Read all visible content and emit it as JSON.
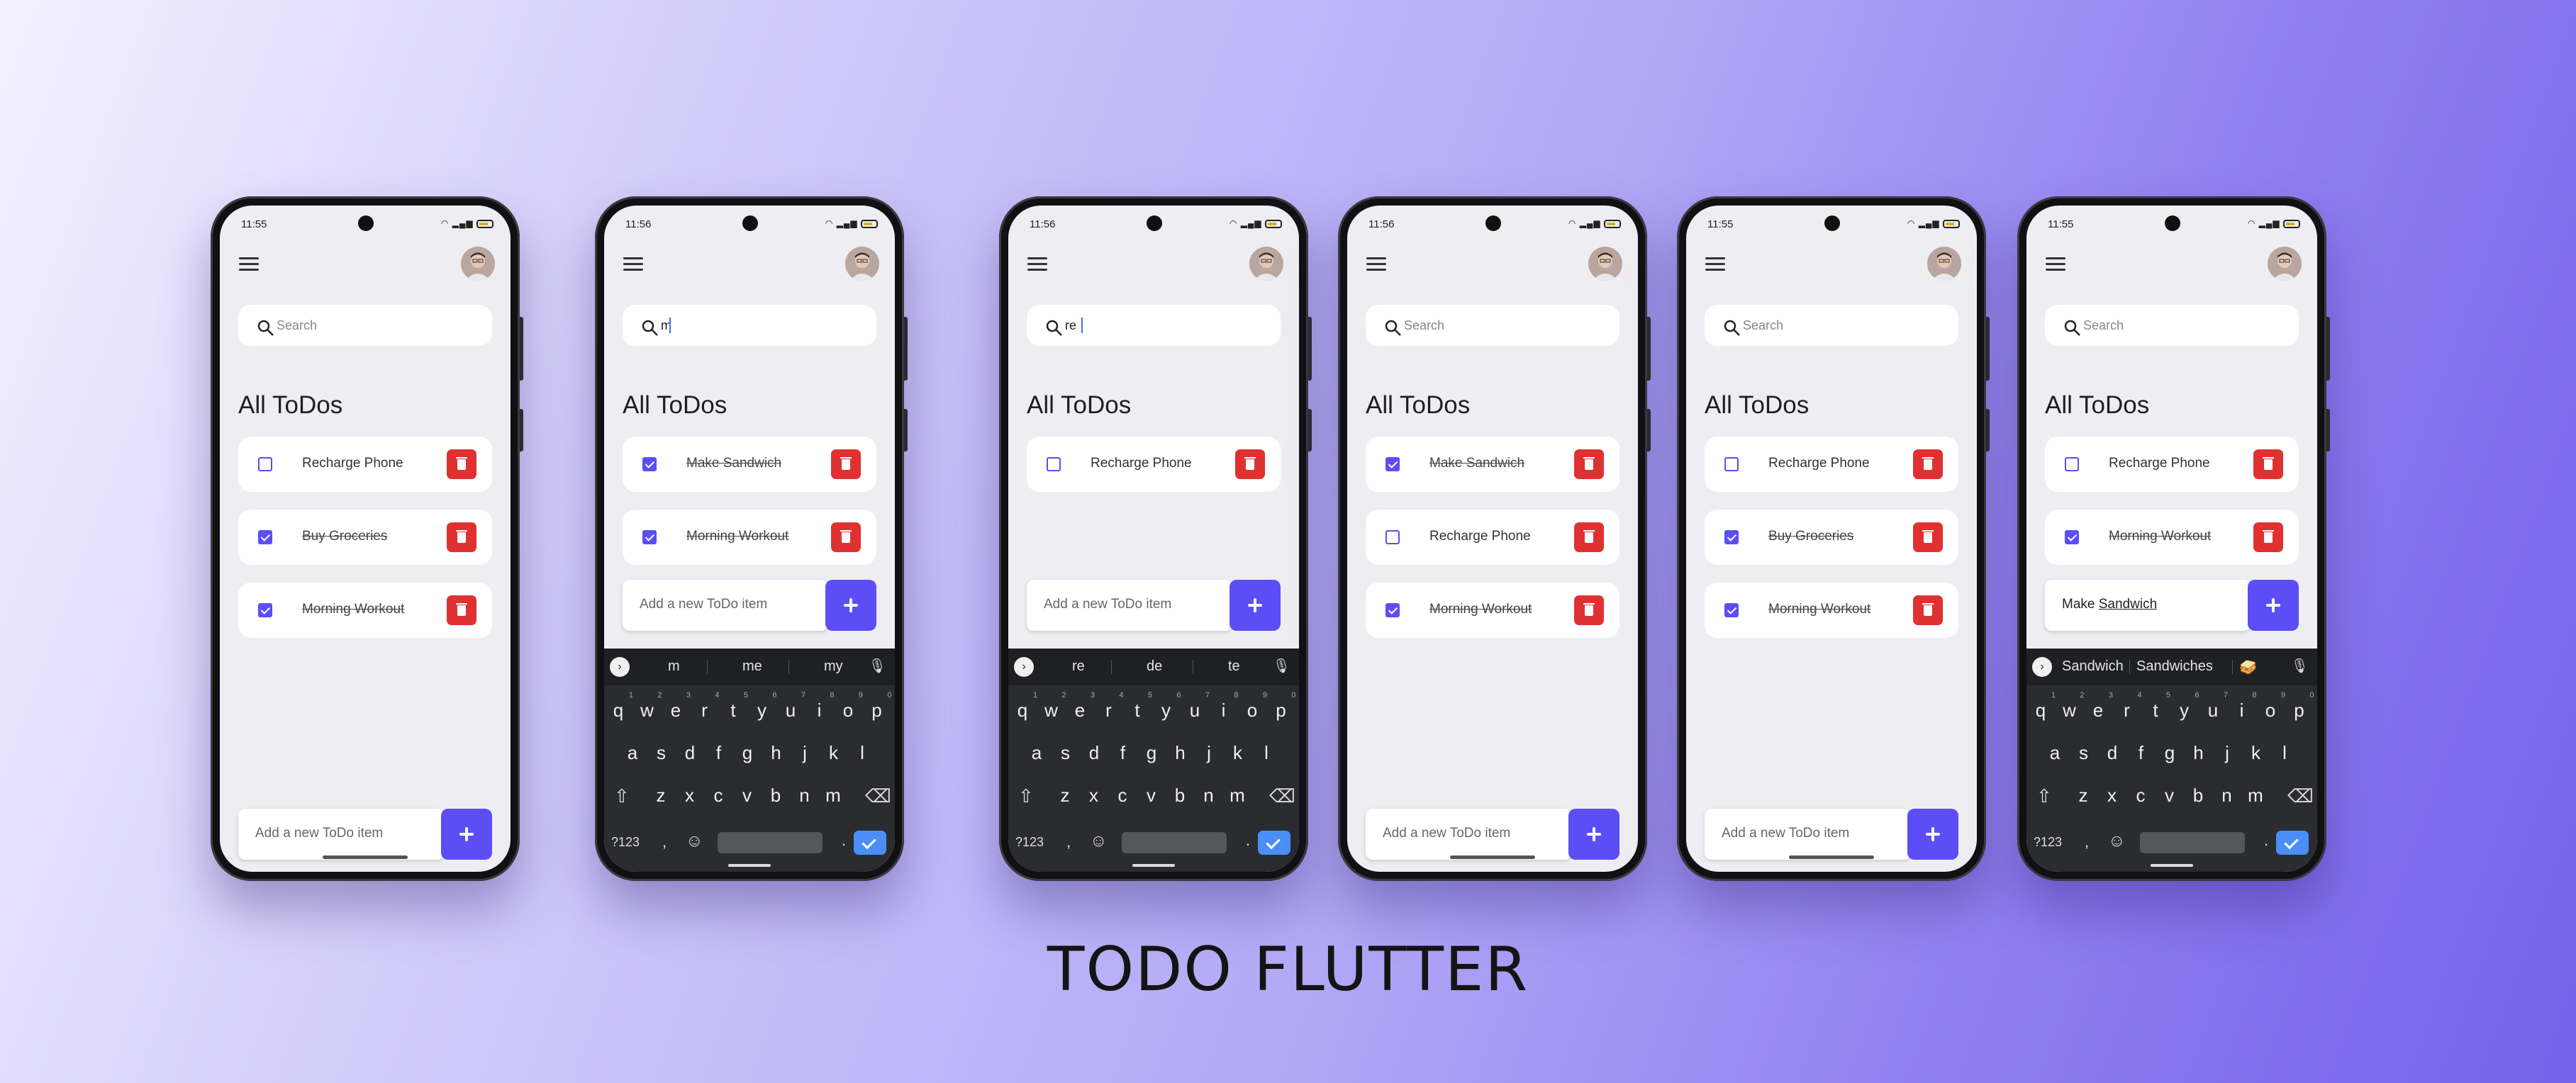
{
  "caption": "TODO FLUTTER",
  "colors": {
    "accent": "#5b4ef6",
    "delete": "#e03131",
    "background_from": "#f3f1ff",
    "background_to": "#7561ea"
  },
  "icons": {
    "menu": "menu-icon",
    "search": "search-icon",
    "delete": "trash-icon",
    "add": "plus-icon",
    "mic": "mic-icon",
    "backspace": "backspace-icon",
    "shift": "shift-icon",
    "emoji": "emoji-icon"
  },
  "keyboard": {
    "row1": [
      "q",
      "w",
      "e",
      "r",
      "t",
      "y",
      "u",
      "i",
      "o",
      "p"
    ],
    "row1_numbers": [
      "1",
      "2",
      "3",
      "4",
      "5",
      "6",
      "7",
      "8",
      "9",
      "0"
    ],
    "row2": [
      "a",
      "s",
      "d",
      "f",
      "g",
      "h",
      "j",
      "k",
      "l"
    ],
    "row3": [
      "z",
      "x",
      "c",
      "v",
      "b",
      "n",
      "m"
    ],
    "symbols_key": "?123",
    "comma": ",",
    "period": "."
  },
  "phones": [
    {
      "time": "11:55",
      "search": "Search",
      "search_typed": false,
      "title": "All ToDos",
      "todos": [
        {
          "text": "Recharge Phone",
          "done": false
        },
        {
          "text": "Buy Groceries",
          "done": true
        },
        {
          "text": "Morning Workout",
          "done": true
        }
      ],
      "add_text": "Add a new ToDo item",
      "add_typed": false,
      "keyboard": false
    },
    {
      "time": "11:56",
      "search": "m",
      "search_typed": true,
      "title": "All ToDos",
      "todos": [
        {
          "text": "Make Sandwich",
          "done": true
        },
        {
          "text": "Morning Workout",
          "done": true
        }
      ],
      "add_text": "Add a new ToDo item",
      "add_typed": false,
      "keyboard": true,
      "suggestions": [
        "m",
        "me",
        "my"
      ]
    },
    {
      "time": "11:56",
      "search": "re",
      "search_typed": true,
      "title": "All ToDos",
      "todos": [
        {
          "text": "Recharge Phone",
          "done": false
        }
      ],
      "add_text": "Add a new ToDo item",
      "add_typed": false,
      "keyboard": true,
      "suggestions": [
        "re",
        "de",
        "te"
      ]
    },
    {
      "time": "11:56",
      "search": "Search",
      "search_typed": false,
      "title": "All ToDos",
      "todos": [
        {
          "text": "Make Sandwich",
          "done": true
        },
        {
          "text": "Recharge Phone",
          "done": false
        },
        {
          "text": "Morning Workout",
          "done": true
        }
      ],
      "add_text": "Add a new ToDo item",
      "add_typed": false,
      "keyboard": false
    },
    {
      "time": "11:55",
      "search": "Search",
      "search_typed": false,
      "title": "All ToDos",
      "todos": [
        {
          "text": "Recharge Phone",
          "done": false
        },
        {
          "text": "Buy Groceries",
          "done": true
        },
        {
          "text": "Morning Workout",
          "done": true
        }
      ],
      "add_text": "Add a new ToDo item",
      "add_typed": false,
      "keyboard": false
    },
    {
      "time": "11:55",
      "search": "Search",
      "search_typed": false,
      "title": "All ToDos",
      "todos": [
        {
          "text": "Recharge Phone",
          "done": false
        },
        {
          "text": "Morning Workout",
          "done": true
        }
      ],
      "add_text": "Make ",
      "add_text_underlined": "Sandwich",
      "add_typed": true,
      "keyboard": true,
      "suggestions": [
        "Sandwich",
        "Sandwiches",
        "🥪"
      ]
    }
  ]
}
